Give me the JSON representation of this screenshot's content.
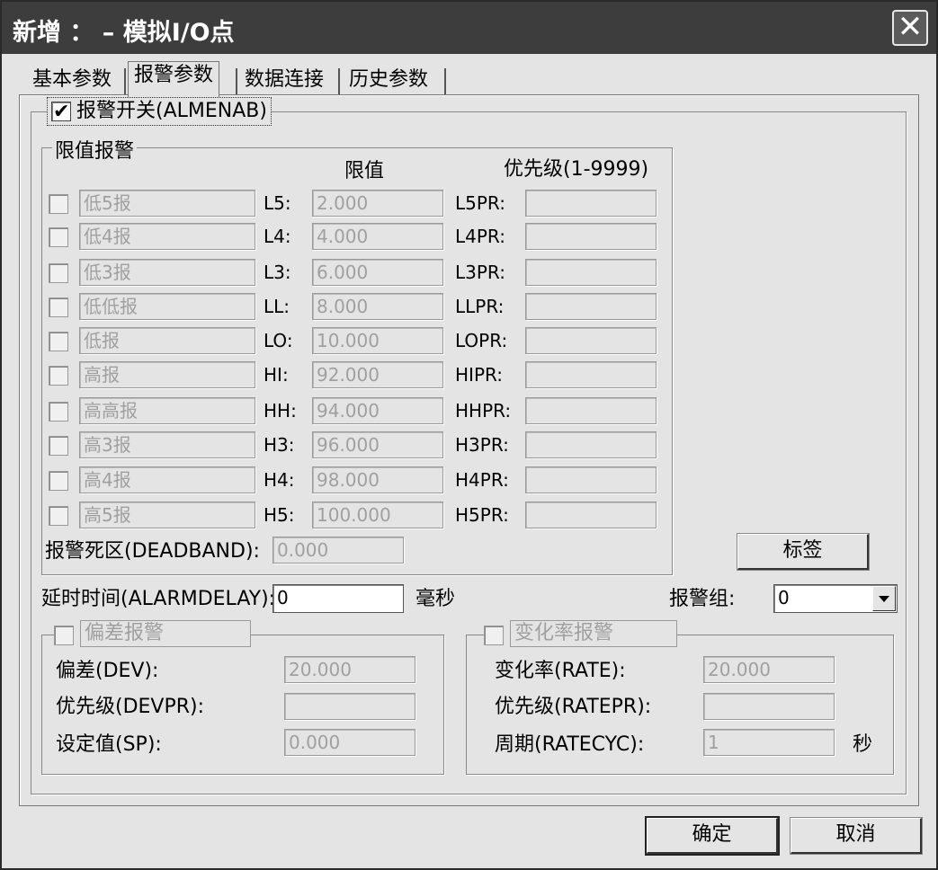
{
  "window": {
    "title": "新增 ： – 模拟I/O点",
    "close_glyph": "✕"
  },
  "tabs": [
    "基本参数",
    "报警参数",
    "数据连接",
    "历史参数"
  ],
  "alarm_switch": {
    "label": "报警开关(ALMENAB)",
    "checked": true
  },
  "limit_group": {
    "title": "限值报警",
    "col_limit": "限值",
    "col_priority": "优先级(1-9999)",
    "rows": [
      {
        "name": "低5报",
        "code": "L5:",
        "value": "2.000",
        "pr_label": "L5PR:",
        "priority": ""
      },
      {
        "name": "低4报",
        "code": "L4:",
        "value": "4.000",
        "pr_label": "L4PR:",
        "priority": ""
      },
      {
        "name": "低3报",
        "code": "L3:",
        "value": "6.000",
        "pr_label": "L3PR:",
        "priority": ""
      },
      {
        "name": "低低报",
        "code": "LL:",
        "value": "8.000",
        "pr_label": "LLPR:",
        "priority": ""
      },
      {
        "name": "低报",
        "code": "LO:",
        "value": "10.000",
        "pr_label": "LOPR:",
        "priority": ""
      },
      {
        "name": "高报",
        "code": "HI:",
        "value": "92.000",
        "pr_label": "HIPR:",
        "priority": ""
      },
      {
        "name": "高高报",
        "code": "HH:",
        "value": "94.000",
        "pr_label": "HHPR:",
        "priority": ""
      },
      {
        "name": "高3报",
        "code": "H3:",
        "value": "96.000",
        "pr_label": "H3PR:",
        "priority": ""
      },
      {
        "name": "高4报",
        "code": "H4:",
        "value": "98.000",
        "pr_label": "H4PR:",
        "priority": ""
      },
      {
        "name": "高5报",
        "code": "H5:",
        "value": "100.000",
        "pr_label": "H5PR:",
        "priority": ""
      }
    ],
    "deadband_label": "报警死区(DEADBAND):",
    "deadband_value": "0.000"
  },
  "tag_button": "标签",
  "delay": {
    "label": "延时时间(ALARMDELAY):",
    "value": "0",
    "unit": "毫秒"
  },
  "alarm_group": {
    "label": "报警组:",
    "value": "0"
  },
  "deviation_group": {
    "title": "偏差报警",
    "dev_label": "偏差(DEV):",
    "dev_value": "20.000",
    "devpr_label": "优先级(DEVPR):",
    "devpr_value": "",
    "sp_label": "设定值(SP):",
    "sp_value": "0.000"
  },
  "rate_group": {
    "title": "变化率报警",
    "rate_label": "变化率(RATE):",
    "rate_value": "20.000",
    "ratepr_label": "优先级(RATEPR):",
    "ratepr_value": "",
    "cyc_label": "周期(RATECYC):",
    "cyc_value": "1",
    "cyc_unit": "秒"
  },
  "footer": {
    "ok": "确定",
    "cancel": "取消"
  }
}
